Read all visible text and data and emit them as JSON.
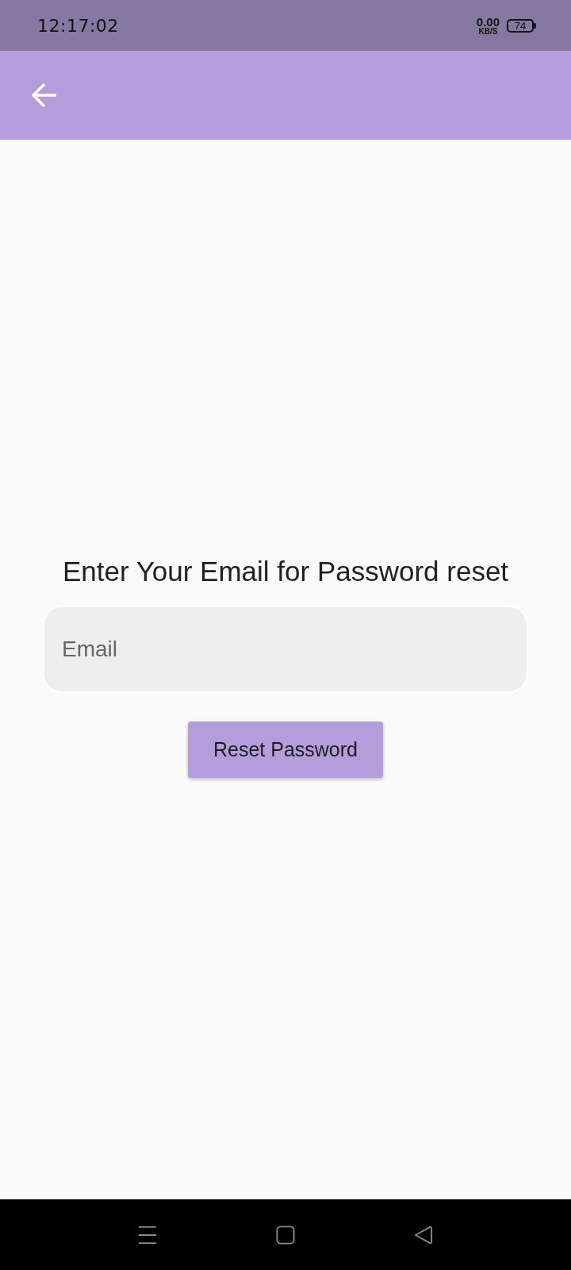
{
  "status_bar": {
    "time": "12:17:02",
    "net_speed": "0.00",
    "net_unit": "KB/S",
    "battery": "74"
  },
  "form": {
    "title": "Enter Your Email for Password reset",
    "email": {
      "placeholder": "Email"
    },
    "button": "Reset Password"
  }
}
